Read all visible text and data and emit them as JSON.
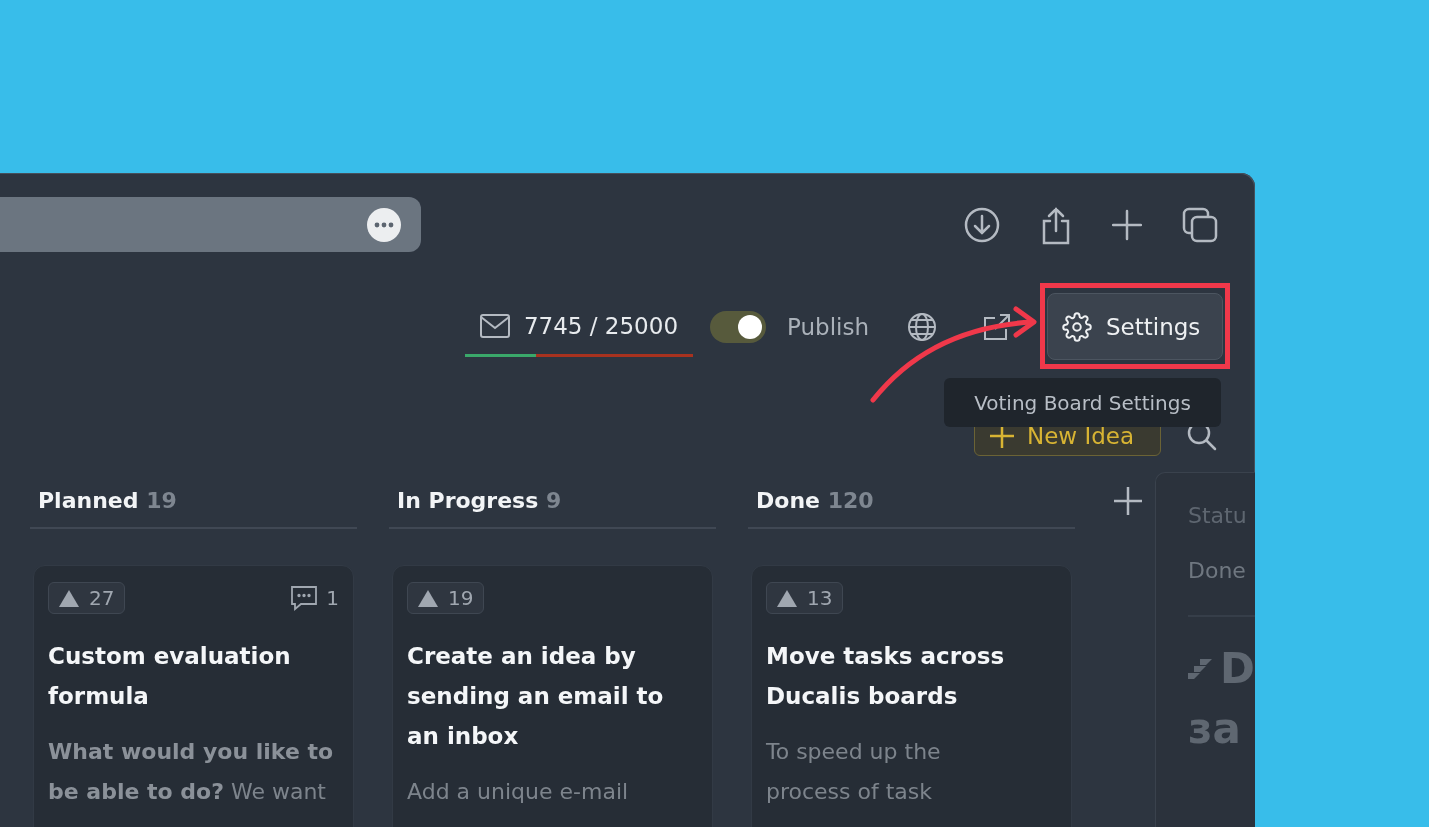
{
  "counter": {
    "text": "7745 / 25000",
    "level": 0.31
  },
  "publish": {
    "label": "Publish",
    "on": true
  },
  "settings_button": {
    "label": "Settings"
  },
  "tooltip": {
    "text": "Voting Board Settings"
  },
  "new_idea_button": {
    "label": "New Idea"
  },
  "columns": [
    {
      "title": "Planned",
      "count": "19",
      "cards": [
        {
          "votes": "27",
          "comments": "1",
          "title_lines": [
            "Custom evaluation",
            "formula"
          ],
          "description_lines": [
            "**What would you like to**",
            "**be able to do?** We want"
          ]
        }
      ]
    },
    {
      "title": "In Progress",
      "count": "9",
      "cards": [
        {
          "votes": "19",
          "title_lines": [
            "Create an idea by",
            "sending an email to",
            "an inbox"
          ],
          "description_lines": [
            "Add a unique e-mail"
          ]
        }
      ]
    },
    {
      "title": "Done",
      "count": "120",
      "cards": [
        {
          "votes": "13",
          "title_lines": [
            "Move tasks across",
            "Ducalis boards"
          ],
          "description_lines": [
            "To speed up the",
            "process of task"
          ]
        }
      ]
    }
  ],
  "side_panel": {
    "field_label": "Statu",
    "field_value": "Done",
    "heading_lines": [
      "D",
      "за"
    ]
  }
}
